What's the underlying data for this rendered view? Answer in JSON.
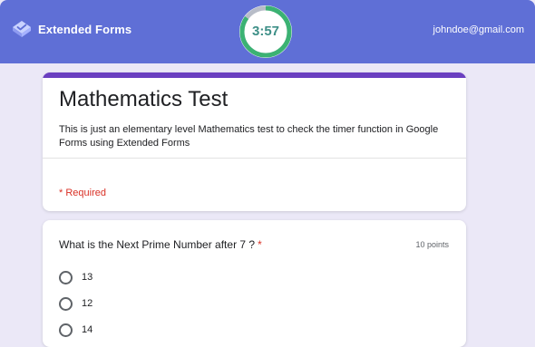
{
  "header": {
    "brand_name": "Extended Forms",
    "logo_icon": "extended-forms-logo-icon",
    "timer": {
      "label": "3:57",
      "remaining_fraction": 0.85,
      "ring_color": "#3bb273",
      "track_color": "#b8bdc8"
    },
    "user_email": "johndoe@gmail.com",
    "background_color": "#5f6fd6"
  },
  "form": {
    "accent_color": "#6a3fc0",
    "title": "Mathematics Test",
    "description": "This is just an elementary level Mathematics test to check the timer function in Google Forms using Extended Forms",
    "required_note": "* Required"
  },
  "question": {
    "text": "What is the Next Prime Number after 7 ?",
    "required_marker": "*",
    "points": "10 points",
    "options": [
      {
        "label": "13",
        "selected": false
      },
      {
        "label": "12",
        "selected": false
      },
      {
        "label": "14",
        "selected": false
      }
    ]
  }
}
